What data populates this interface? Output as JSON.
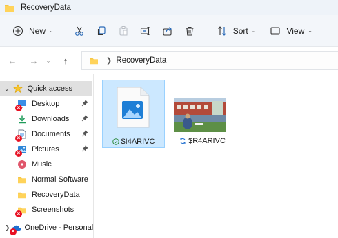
{
  "window": {
    "title": "RecoveryData"
  },
  "toolbar": {
    "new_label": "New",
    "sort_label": "Sort",
    "view_label": "View",
    "icons": [
      "new-icon",
      "cut-icon",
      "copy-icon",
      "paste-icon",
      "rename-icon",
      "share-icon",
      "delete-icon",
      "sort-icon",
      "view-icon"
    ]
  },
  "navigation": {
    "breadcrumb": [
      "RecoveryData"
    ]
  },
  "sidebar": {
    "quick_access": "Quick access",
    "items": [
      {
        "label": "Desktop",
        "icon": "desktop-icon",
        "pinned": true,
        "error": true
      },
      {
        "label": "Downloads",
        "icon": "download-icon",
        "pinned": true,
        "error": false
      },
      {
        "label": "Documents",
        "icon": "documents-icon",
        "pinned": true,
        "error": true
      },
      {
        "label": "Pictures",
        "icon": "pictures-icon",
        "pinned": true,
        "error": true
      },
      {
        "label": "Music",
        "icon": "music-icon",
        "pinned": false,
        "error": false
      },
      {
        "label": "Normal Software",
        "icon": "folder-icon",
        "pinned": false,
        "error": false
      },
      {
        "label": "RecoveryData",
        "icon": "folder-icon",
        "pinned": false,
        "error": false
      },
      {
        "label": "Screenshots",
        "icon": "folder-icon",
        "pinned": false,
        "error": true
      }
    ],
    "onedrive": "OneDrive - Personal"
  },
  "files": [
    {
      "name": "$I4ARIVC",
      "status": "synced",
      "selected": true
    },
    {
      "name": "$R4ARIVC",
      "status": "syncing",
      "selected": false
    }
  ],
  "colors": {
    "accent": "#0067c0",
    "folder": "#f6c643",
    "selection": "#cce8ff",
    "error": "#e81123",
    "synced": "#2e8b3d"
  }
}
